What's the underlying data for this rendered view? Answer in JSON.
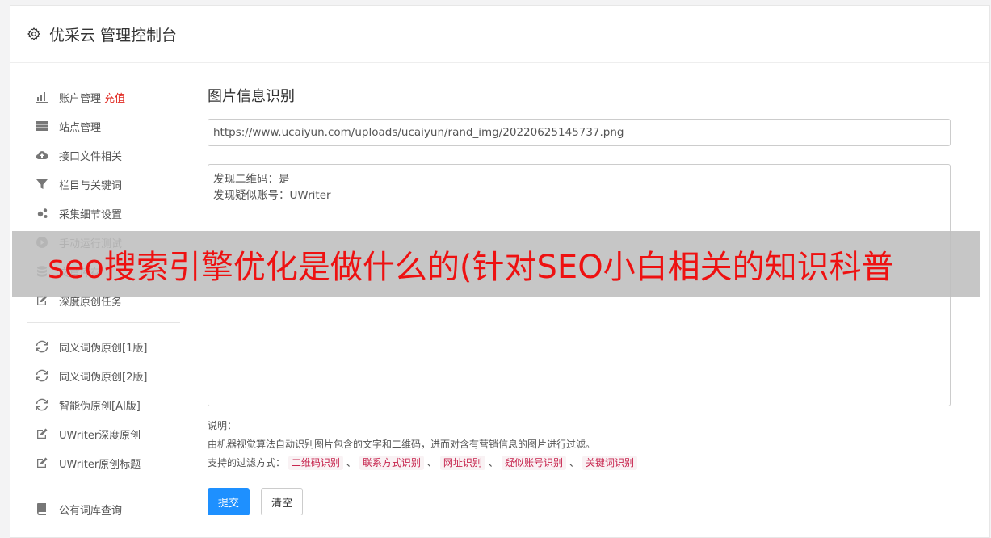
{
  "header": {
    "title": "优采云 管理控制台",
    "icon": "gear-icon"
  },
  "sidebar": {
    "groups": [
      [
        {
          "label": "账户管理",
          "badge": "充值",
          "icon": "bar-chart-icon"
        },
        {
          "label": "站点管理",
          "icon": "server-icon"
        },
        {
          "label": "接口文件相关",
          "icon": "cloud-upload-icon"
        },
        {
          "label": "栏目与关键词",
          "icon": "filter-icon"
        },
        {
          "label": "采集细节设置",
          "icon": "gears-icon"
        },
        {
          "label": "手动运行测试",
          "icon": "play-circle-icon"
        },
        {
          "label": "文章库存",
          "icon": "database-icon"
        },
        {
          "label": "深度原创任务",
          "icon": "edit-icon"
        }
      ],
      [
        {
          "label": "同义词伪原创[1版]",
          "icon": "refresh-icon"
        },
        {
          "label": "同义词伪原创[2版]",
          "icon": "refresh-icon"
        },
        {
          "label": "智能伪原创[AI版]",
          "icon": "refresh-icon"
        },
        {
          "label": "UWriter深度原创",
          "icon": "edit-icon"
        },
        {
          "label": "UWriter原创标题",
          "icon": "edit-icon"
        }
      ],
      [
        {
          "label": "公有词库查询",
          "icon": "book-icon"
        }
      ]
    ]
  },
  "main": {
    "title": "图片信息识别",
    "url_value": "https://www.ucaiyun.com/uploads/ucaiyun/rand_img/20220625145737.png",
    "result_lines": [
      "发现二维码：是",
      "发现疑似账号：UWriter"
    ],
    "desc_label": "说明：",
    "desc_text": "由机器视觉算法自动识别图片包含的文字和二维码，进而对含有营销信息的图片进行过滤。",
    "filter_label": "支持的过滤方式：",
    "filters": [
      "二维码识别",
      "联系方式识别",
      "网址识别",
      "疑似账号识别",
      "关键词识别"
    ],
    "filter_sep": "、",
    "submit_label": "提交",
    "clear_label": "清空"
  },
  "overlay": {
    "text": "seo搜索引擎优化是做什么的(针对SEO小白相关的知识科普"
  },
  "colors": {
    "primary": "#1e90ff",
    "badge": "#e0271f",
    "tag": "#c7254e",
    "overlay_text": "#ee1111"
  }
}
